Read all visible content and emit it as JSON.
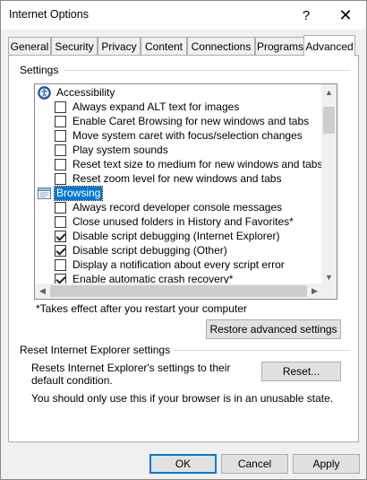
{
  "window": {
    "title": "Internet Options",
    "help_label": "?",
    "close_label": "✕"
  },
  "tabs": [
    {
      "label": "General"
    },
    {
      "label": "Security"
    },
    {
      "label": "Privacy"
    },
    {
      "label": "Content"
    },
    {
      "label": "Connections"
    },
    {
      "label": "Programs"
    },
    {
      "label": "Advanced",
      "active": true
    }
  ],
  "settings": {
    "group_label": "Settings",
    "items": [
      {
        "type": "category",
        "label": "Accessibility",
        "icon": "accessibility-icon"
      },
      {
        "type": "option",
        "label": "Always expand ALT text for images",
        "checked": false
      },
      {
        "type": "option",
        "label": "Enable Caret Browsing for new windows and tabs",
        "checked": false
      },
      {
        "type": "option",
        "label": "Move system caret with focus/selection changes",
        "checked": false
      },
      {
        "type": "option",
        "label": "Play system sounds",
        "checked": false
      },
      {
        "type": "option",
        "label": "Reset text size to medium for new windows and tabs",
        "checked": false
      },
      {
        "type": "option",
        "label": "Reset zoom level for new windows and tabs",
        "checked": false
      },
      {
        "type": "category",
        "label": "Browsing",
        "icon": "browsing-icon",
        "selected": true
      },
      {
        "type": "option",
        "label": "Always record developer console messages",
        "checked": false
      },
      {
        "type": "option",
        "label": "Close unused folders in History and Favorites*",
        "checked": false
      },
      {
        "type": "option",
        "label": "Disable script debugging (Internet Explorer)",
        "checked": true
      },
      {
        "type": "option",
        "label": "Disable script debugging (Other)",
        "checked": true
      },
      {
        "type": "option",
        "label": "Display a notification about every script error",
        "checked": false
      },
      {
        "type": "option",
        "label": "Enable automatic crash recovery*",
        "checked": true
      }
    ],
    "scroll_up": "▲",
    "scroll_down": "▼",
    "scroll_left": "◀",
    "scroll_right": "▶",
    "restart_note": "*Takes effect after you restart your computer",
    "restore_label": "Restore advanced settings"
  },
  "reset": {
    "group_label": "Reset Internet Explorer settings",
    "description": "Resets Internet Explorer's settings to their default condition.",
    "button_label": "Reset...",
    "warning": "You should only use this if your browser is in an unusable state."
  },
  "footer": {
    "ok_label": "OK",
    "cancel_label": "Cancel",
    "apply_label": "Apply"
  },
  "colors": {
    "selection": "#0078d7",
    "accent_border": "#0078d7",
    "dialog_bg": "#f0f0f0"
  }
}
